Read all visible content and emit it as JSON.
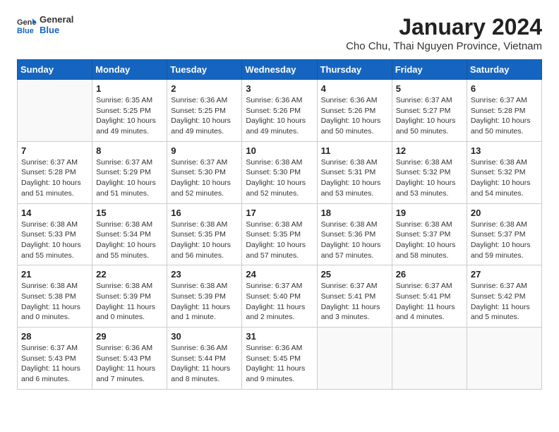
{
  "logo": {
    "general": "General",
    "blue": "Blue"
  },
  "header": {
    "month_year": "January 2024",
    "location": "Cho Chu, Thai Nguyen Province, Vietnam"
  },
  "weekdays": [
    "Sunday",
    "Monday",
    "Tuesday",
    "Wednesday",
    "Thursday",
    "Friday",
    "Saturday"
  ],
  "weeks": [
    [
      {
        "day": "",
        "sunrise": "",
        "sunset": "",
        "daylight": ""
      },
      {
        "day": "1",
        "sunrise": "Sunrise: 6:35 AM",
        "sunset": "Sunset: 5:25 PM",
        "daylight": "Daylight: 10 hours and 49 minutes."
      },
      {
        "day": "2",
        "sunrise": "Sunrise: 6:36 AM",
        "sunset": "Sunset: 5:25 PM",
        "daylight": "Daylight: 10 hours and 49 minutes."
      },
      {
        "day": "3",
        "sunrise": "Sunrise: 6:36 AM",
        "sunset": "Sunset: 5:26 PM",
        "daylight": "Daylight: 10 hours and 49 minutes."
      },
      {
        "day": "4",
        "sunrise": "Sunrise: 6:36 AM",
        "sunset": "Sunset: 5:26 PM",
        "daylight": "Daylight: 10 hours and 50 minutes."
      },
      {
        "day": "5",
        "sunrise": "Sunrise: 6:37 AM",
        "sunset": "Sunset: 5:27 PM",
        "daylight": "Daylight: 10 hours and 50 minutes."
      },
      {
        "day": "6",
        "sunrise": "Sunrise: 6:37 AM",
        "sunset": "Sunset: 5:28 PM",
        "daylight": "Daylight: 10 hours and 50 minutes."
      }
    ],
    [
      {
        "day": "7",
        "sunrise": "Sunrise: 6:37 AM",
        "sunset": "Sunset: 5:28 PM",
        "daylight": "Daylight: 10 hours and 51 minutes."
      },
      {
        "day": "8",
        "sunrise": "Sunrise: 6:37 AM",
        "sunset": "Sunset: 5:29 PM",
        "daylight": "Daylight: 10 hours and 51 minutes."
      },
      {
        "day": "9",
        "sunrise": "Sunrise: 6:37 AM",
        "sunset": "Sunset: 5:30 PM",
        "daylight": "Daylight: 10 hours and 52 minutes."
      },
      {
        "day": "10",
        "sunrise": "Sunrise: 6:38 AM",
        "sunset": "Sunset: 5:30 PM",
        "daylight": "Daylight: 10 hours and 52 minutes."
      },
      {
        "day": "11",
        "sunrise": "Sunrise: 6:38 AM",
        "sunset": "Sunset: 5:31 PM",
        "daylight": "Daylight: 10 hours and 53 minutes."
      },
      {
        "day": "12",
        "sunrise": "Sunrise: 6:38 AM",
        "sunset": "Sunset: 5:32 PM",
        "daylight": "Daylight: 10 hours and 53 minutes."
      },
      {
        "day": "13",
        "sunrise": "Sunrise: 6:38 AM",
        "sunset": "Sunset: 5:32 PM",
        "daylight": "Daylight: 10 hours and 54 minutes."
      }
    ],
    [
      {
        "day": "14",
        "sunrise": "Sunrise: 6:38 AM",
        "sunset": "Sunset: 5:33 PM",
        "daylight": "Daylight: 10 hours and 55 minutes."
      },
      {
        "day": "15",
        "sunrise": "Sunrise: 6:38 AM",
        "sunset": "Sunset: 5:34 PM",
        "daylight": "Daylight: 10 hours and 55 minutes."
      },
      {
        "day": "16",
        "sunrise": "Sunrise: 6:38 AM",
        "sunset": "Sunset: 5:35 PM",
        "daylight": "Daylight: 10 hours and 56 minutes."
      },
      {
        "day": "17",
        "sunrise": "Sunrise: 6:38 AM",
        "sunset": "Sunset: 5:35 PM",
        "daylight": "Daylight: 10 hours and 57 minutes."
      },
      {
        "day": "18",
        "sunrise": "Sunrise: 6:38 AM",
        "sunset": "Sunset: 5:36 PM",
        "daylight": "Daylight: 10 hours and 57 minutes."
      },
      {
        "day": "19",
        "sunrise": "Sunrise: 6:38 AM",
        "sunset": "Sunset: 5:37 PM",
        "daylight": "Daylight: 10 hours and 58 minutes."
      },
      {
        "day": "20",
        "sunrise": "Sunrise: 6:38 AM",
        "sunset": "Sunset: 5:37 PM",
        "daylight": "Daylight: 10 hours and 59 minutes."
      }
    ],
    [
      {
        "day": "21",
        "sunrise": "Sunrise: 6:38 AM",
        "sunset": "Sunset: 5:38 PM",
        "daylight": "Daylight: 11 hours and 0 minutes."
      },
      {
        "day": "22",
        "sunrise": "Sunrise: 6:38 AM",
        "sunset": "Sunset: 5:39 PM",
        "daylight": "Daylight: 11 hours and 0 minutes."
      },
      {
        "day": "23",
        "sunrise": "Sunrise: 6:38 AM",
        "sunset": "Sunset: 5:39 PM",
        "daylight": "Daylight: 11 hours and 1 minute."
      },
      {
        "day": "24",
        "sunrise": "Sunrise: 6:37 AM",
        "sunset": "Sunset: 5:40 PM",
        "daylight": "Daylight: 11 hours and 2 minutes."
      },
      {
        "day": "25",
        "sunrise": "Sunrise: 6:37 AM",
        "sunset": "Sunset: 5:41 PM",
        "daylight": "Daylight: 11 hours and 3 minutes."
      },
      {
        "day": "26",
        "sunrise": "Sunrise: 6:37 AM",
        "sunset": "Sunset: 5:41 PM",
        "daylight": "Daylight: 11 hours and 4 minutes."
      },
      {
        "day": "27",
        "sunrise": "Sunrise: 6:37 AM",
        "sunset": "Sunset: 5:42 PM",
        "daylight": "Daylight: 11 hours and 5 minutes."
      }
    ],
    [
      {
        "day": "28",
        "sunrise": "Sunrise: 6:37 AM",
        "sunset": "Sunset: 5:43 PM",
        "daylight": "Daylight: 11 hours and 6 minutes."
      },
      {
        "day": "29",
        "sunrise": "Sunrise: 6:36 AM",
        "sunset": "Sunset: 5:43 PM",
        "daylight": "Daylight: 11 hours and 7 minutes."
      },
      {
        "day": "30",
        "sunrise": "Sunrise: 6:36 AM",
        "sunset": "Sunset: 5:44 PM",
        "daylight": "Daylight: 11 hours and 8 minutes."
      },
      {
        "day": "31",
        "sunrise": "Sunrise: 6:36 AM",
        "sunset": "Sunset: 5:45 PM",
        "daylight": "Daylight: 11 hours and 9 minutes."
      },
      {
        "day": "",
        "sunrise": "",
        "sunset": "",
        "daylight": ""
      },
      {
        "day": "",
        "sunrise": "",
        "sunset": "",
        "daylight": ""
      },
      {
        "day": "",
        "sunrise": "",
        "sunset": "",
        "daylight": ""
      }
    ]
  ]
}
